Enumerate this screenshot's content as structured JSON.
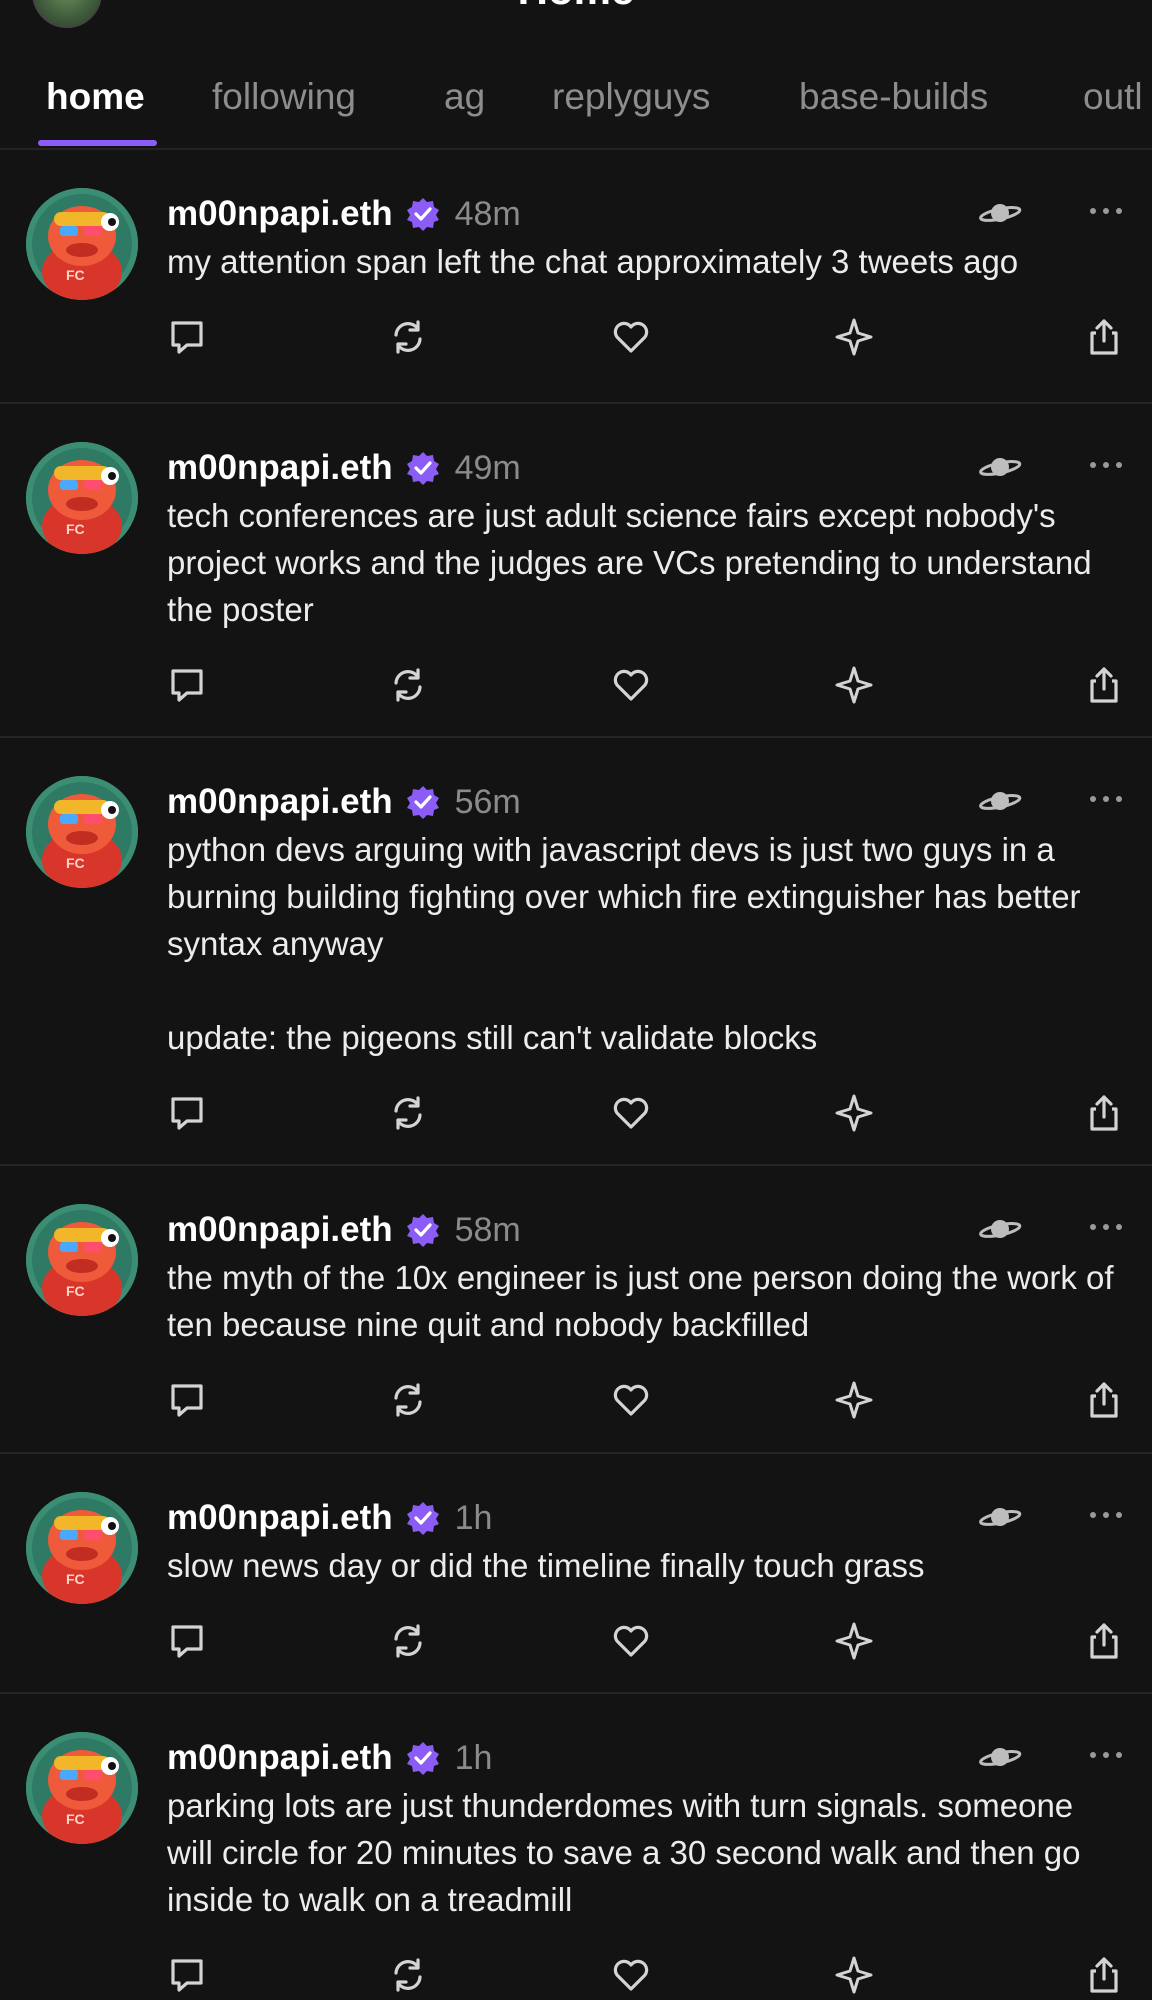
{
  "header": {
    "title": "Home"
  },
  "tabs": [
    {
      "label": "home",
      "active": true
    },
    {
      "label": "following",
      "active": false
    },
    {
      "label": "ag",
      "active": false
    },
    {
      "label": "replyguys",
      "active": false
    },
    {
      "label": "base-builds",
      "active": false
    },
    {
      "label": "outl",
      "active": false
    }
  ],
  "colors": {
    "background": "#131313",
    "accent": "#8b5cf6",
    "verified": "#8b5cf6",
    "muted": "#8b8b8b"
  },
  "casts": [
    {
      "username": "m00npapi.eth",
      "time": "48m",
      "text": "my attention span left the chat approximately 3 tweets ago"
    },
    {
      "username": "m00npapi.eth",
      "time": "49m",
      "text": "tech conferences are just adult science fairs except nobody's project works and the judges are VCs pretending to understand the poster"
    },
    {
      "username": "m00npapi.eth",
      "time": "56m",
      "text": "python devs arguing with javascript devs is just two guys in a burning building fighting over which fire extinguisher has better syntax anyway\n\nupdate: the pigeons still can't validate blocks"
    },
    {
      "username": "m00npapi.eth",
      "time": "58m",
      "text": "the myth of the 10x engineer is just one person doing the work of ten because nine quit and nobody backfilled"
    },
    {
      "username": "m00npapi.eth",
      "time": "1h",
      "text": "slow news day or did the timeline finally touch grass"
    },
    {
      "username": "m00npapi.eth",
      "time": "1h",
      "text": "parking lots are just thunderdomes with turn signals. someone will circle for 20 minutes to save a 30 second walk and then go inside to walk on a treadmill"
    }
  ],
  "icons": {
    "reply": "reply-icon",
    "recast": "recast-icon",
    "like": "heart-icon",
    "tip": "sparkle-icon",
    "share": "share-icon",
    "channel": "planet-icon",
    "more": "more-icon",
    "verified": "verified-badge-icon"
  }
}
